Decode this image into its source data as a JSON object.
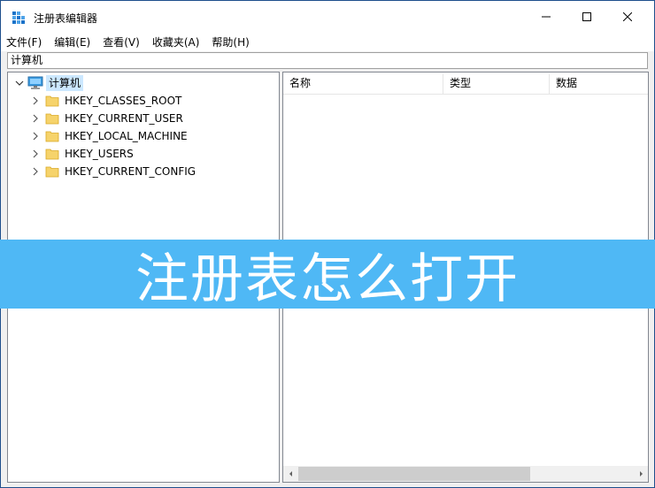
{
  "window": {
    "title": "注册表编辑器",
    "icon": "regedit-icon"
  },
  "controls": {
    "minimize": "minimize-icon",
    "maximize": "maximize-icon",
    "close": "close-icon"
  },
  "menu": [
    {
      "label": "文件(F)"
    },
    {
      "label": "编辑(E)"
    },
    {
      "label": "查看(V)"
    },
    {
      "label": "收藏夹(A)"
    },
    {
      "label": "帮助(H)"
    }
  ],
  "address": "计算机",
  "tree": {
    "root": {
      "label": "计算机",
      "icon": "computer-icon"
    },
    "hives": [
      {
        "label": "HKEY_CLASSES_ROOT"
      },
      {
        "label": "HKEY_CURRENT_USER"
      },
      {
        "label": "HKEY_LOCAL_MACHINE"
      },
      {
        "label": "HKEY_USERS"
      },
      {
        "label": "HKEY_CURRENT_CONFIG"
      }
    ]
  },
  "list": {
    "columns": [
      {
        "label": "名称"
      },
      {
        "label": "类型"
      },
      {
        "label": "数据"
      }
    ]
  },
  "banner": {
    "text": "注册表怎么打开",
    "color": "#4fb8f5"
  }
}
